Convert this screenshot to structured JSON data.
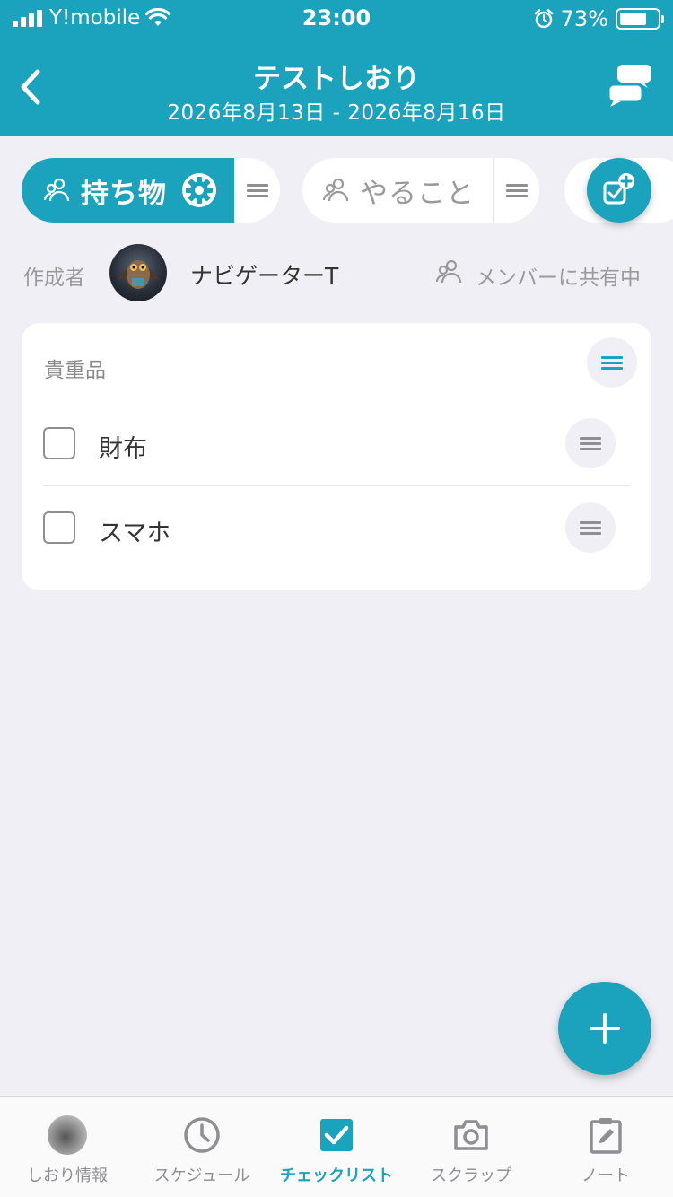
{
  "status_bar": {
    "carrier": "Y!mobile",
    "time": "23:00",
    "battery_percent": "73%",
    "battery_level": 0.73
  },
  "header": {
    "title": "テストしおり",
    "date_range": "2026年8月13日 - 2026年8月16日",
    "background_color": "#1ba3bd"
  },
  "tabs": [
    {
      "label": "持ち物",
      "active": true
    },
    {
      "label": "やること",
      "active": false
    }
  ],
  "author": {
    "label": "作成者",
    "name": "ナビゲーターT",
    "share_status": "メンバーに共有中"
  },
  "card": {
    "title": "貴重品",
    "items": [
      {
        "label": "財布",
        "checked": false
      },
      {
        "label": "スマホ",
        "checked": false
      }
    ]
  },
  "bottom_nav": [
    {
      "label": "しおり情報",
      "icon": "avatar-photo-icon",
      "active": false
    },
    {
      "label": "スケジュール",
      "icon": "clock-icon",
      "active": false
    },
    {
      "label": "チェックリスト",
      "icon": "checkbox-icon",
      "active": true
    },
    {
      "label": "スクラップ",
      "icon": "camera-icon",
      "active": false
    },
    {
      "label": "ノート",
      "icon": "clipboard-edit-icon",
      "active": false
    }
  ],
  "colors": {
    "accent": "#1ba3bd",
    "background": "#f0eff5",
    "muted_text": "#9a9a9a"
  }
}
